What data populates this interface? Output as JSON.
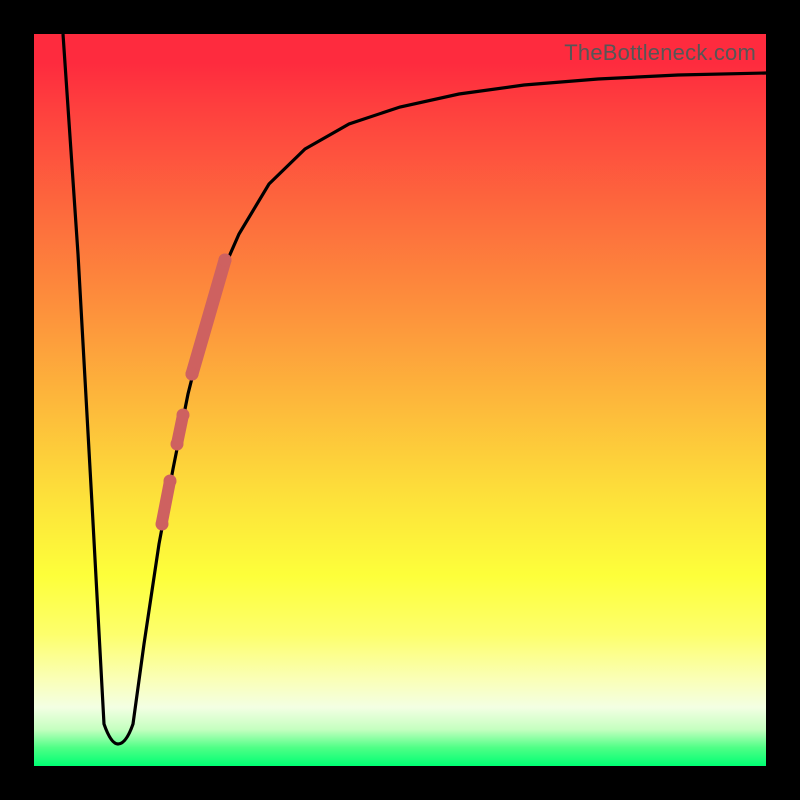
{
  "watermark": "TheBottleneck.com",
  "colors": {
    "frame": "#000000",
    "curve": "#000000",
    "marker": "#ce6160"
  },
  "chart_data": {
    "type": "line",
    "title": "",
    "xlabel": "",
    "ylabel": "",
    "xlim": [
      0,
      100
    ],
    "ylim": [
      0,
      100
    ],
    "grid": false,
    "legend": false,
    "annotations": [
      "TheBottleneck.com"
    ],
    "series": [
      {
        "name": "bottleneck-curve",
        "note": "x in arbitrary units across plot width; y = 100 is top (red / high bottleneck), y = 0 is bottom (green / no bottleneck). Values estimated from figure.",
        "x": [
          4,
          6,
          8,
          9.5,
          10.5,
          12,
          13.5,
          15,
          17,
          19,
          21,
          23,
          25,
          28,
          32,
          37,
          43,
          50,
          58,
          67,
          77,
          88,
          100
        ],
        "y": [
          100,
          70,
          35,
          6,
          3,
          3,
          6,
          17,
          30,
          41,
          51,
          59,
          66,
          73,
          79,
          84,
          87.5,
          90,
          91.8,
          93,
          93.8,
          94.3,
          94.6
        ]
      }
    ],
    "markers": {
      "name": "highlighted-range",
      "note": "salmon overlay segments along the rising branch, (x,y) estimated",
      "segments": [
        {
          "x": [
            17.5,
            18.5
          ],
          "y": [
            33,
            39
          ]
        },
        {
          "x": [
            19.5,
            20.3
          ],
          "y": [
            44,
            48
          ]
        },
        {
          "x": [
            21.5,
            26.0
          ],
          "y": [
            54,
            69
          ]
        }
      ],
      "dots": [
        {
          "x": 17.5,
          "y": 33
        },
        {
          "x": 18.5,
          "y": 39
        },
        {
          "x": 19.5,
          "y": 44
        },
        {
          "x": 20.3,
          "y": 48
        },
        {
          "x": 21.5,
          "y": 54
        },
        {
          "x": 26.0,
          "y": 69
        }
      ]
    }
  }
}
